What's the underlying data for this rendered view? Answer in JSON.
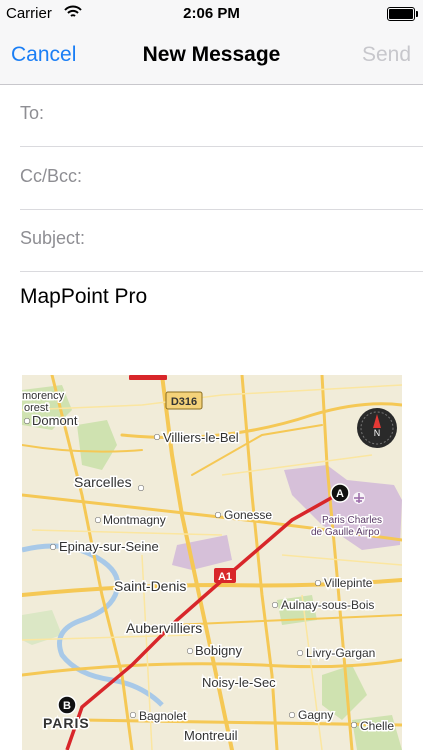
{
  "status_bar": {
    "carrier": "Carrier",
    "time": "2:06 PM"
  },
  "navbar": {
    "cancel": "Cancel",
    "title": "New Message",
    "send": "Send"
  },
  "fields": {
    "to": "To:",
    "cc_bcc": "Cc/Bcc:",
    "subject": "Subject:"
  },
  "body": {
    "text": "MapPoint Pro"
  },
  "map": {
    "road_sign": "D316",
    "highway_sign": "A1",
    "markers": {
      "start": "A",
      "end": "B"
    },
    "compass": "N",
    "places": {
      "montmorency": "morency",
      "foret": "orest",
      "domont": "Domont",
      "villiers_le_bel": "Villiers-le-Bel",
      "sarcelles": "Sarcelles",
      "montmagny": "Montmagny",
      "gonesse": "Gonesse",
      "epinay": "Epinay-sur-Seine",
      "saint_denis": "Saint-Denis",
      "villepinte": "Villepinte",
      "aulnay": "Aulnay-sous-Bois",
      "aubervilliers": "Aubervilliers",
      "bobigny": "Bobigny",
      "livry": "Livry-Gargan",
      "noisy": "Noisy-le-Sec",
      "paris": "PARIS",
      "bagnolet": "Bagnolet",
      "gagny": "Gagny",
      "montreuil": "Montreuil",
      "chelles": "Chelle",
      "cdg_1": "Paris Charles",
      "cdg_2": "de Gaulle Airpo"
    }
  }
}
